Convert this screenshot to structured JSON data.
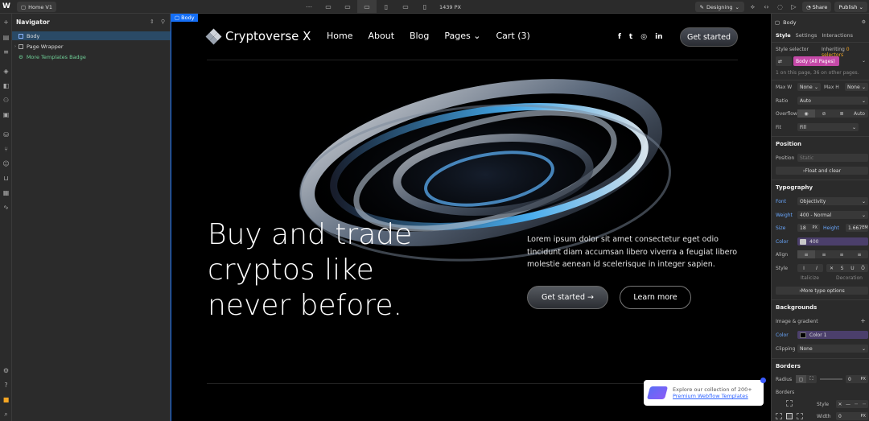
{
  "topbar": {
    "logo": "W",
    "page_name": "Home V1",
    "viewport_width": "1439 PX",
    "mode": "Designing",
    "share": "Share",
    "publish": "Publish"
  },
  "navigator": {
    "title": "Navigator",
    "items": [
      {
        "label": "Body"
      },
      {
        "label": "Page Wrapper"
      },
      {
        "label": "More Templates Badge"
      }
    ]
  },
  "canvas": {
    "body_tag": "Body",
    "site_name": "Cryptoverse X",
    "nav": [
      "Home",
      "About",
      "Blog",
      "Pages",
      "Cart (3)"
    ],
    "social_icons": [
      "facebook-icon",
      "twitter-icon",
      "instagram-icon",
      "linkedin-icon"
    ],
    "header_button": "Get started",
    "headline_1": "Buy and trade",
    "headline_2": "cryptos like",
    "headline_3": "never before.",
    "paragraph": "Lorem ipsum dolor sit amet consectetur eget odio tincidunt diam accumsan libero viverra a feugiat libero molestie aenean id scelerisque in integer sapien.",
    "primary_button": "Get started →",
    "secondary_button": "Learn more",
    "promo_line1": "Explore our collection of 200+",
    "promo_line2": "Premium Webflow Templates"
  },
  "panel": {
    "element": "Body",
    "tabs": [
      "Style",
      "Settings",
      "Interactions"
    ],
    "style_selector_label": "Style selector",
    "inheriting": "Inheriting",
    "inheriting_count": "0 selectors",
    "selector": "Body (All Pages)",
    "on_page": "1 on this page, 36 on other pages.",
    "max_w_label": "Max W",
    "max_w": "None",
    "max_h_label": "Max H",
    "max_h": "None",
    "ratio_label": "Ratio",
    "ratio": "Auto",
    "overflow_label": "Overflow",
    "overflow_auto": "Auto",
    "fit_label": "Fit",
    "fit": "Fill",
    "position_title": "Position",
    "position_label": "Position",
    "position_value": "Static",
    "float_clear": "Float and clear",
    "typography_title": "Typography",
    "font_label": "Font",
    "font": "Objectivity",
    "weight_label": "Weight",
    "weight": "400 - Normal",
    "size_label": "Size",
    "size": "18",
    "size_unit": "PX",
    "height_label": "Height",
    "height": "1.667",
    "height_unit": "EM",
    "color_label": "Color",
    "color_value": "400",
    "align_label": "Align",
    "style_label": "Style",
    "italicize": "Italicize",
    "decoration": "Decoration",
    "more_type": "More type options",
    "backgrounds_title": "Backgrounds",
    "image_gradient": "Image & gradient",
    "bg_color_label": "Color",
    "bg_color": "Color 1",
    "clipping_label": "Clipping",
    "clipping": "None",
    "borders_title": "Borders",
    "radius_label": "Radius",
    "radius_value": "0",
    "radius_unit": "PX",
    "borders_label": "Borders",
    "border_style_label": "Style",
    "border_width_label": "Width",
    "border_width": "0",
    "border_width_unit": "PX"
  },
  "colors": {
    "accent": "#146ef5",
    "selector": "#c549a8",
    "canvas_bg": "#000000",
    "panel_bg": "#2b2b2b"
  }
}
